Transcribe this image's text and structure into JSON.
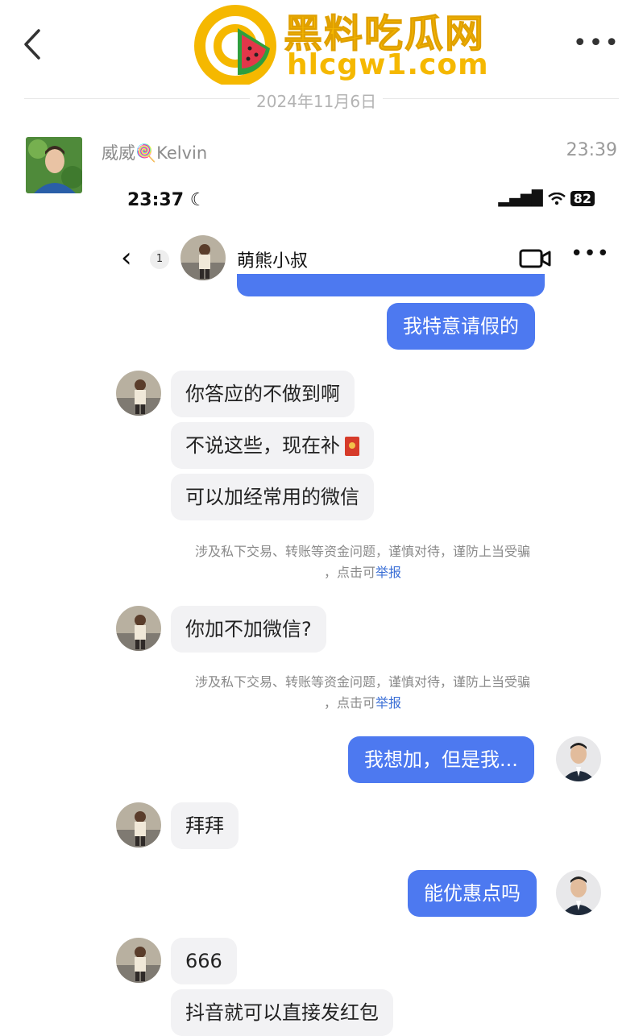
{
  "header": {
    "logo_title": "黑料吃瓜网",
    "logo_url": "hlcgw1.com",
    "more": "•••"
  },
  "date": "2024年11月6日",
  "post": {
    "sender": "威威🍭Kelvin",
    "time": "23:39"
  },
  "inner": {
    "status_time": "23:37",
    "battery": "82",
    "back_badge": "1",
    "contact_name": "萌熊小叔",
    "more": "•••"
  },
  "messages": [
    {
      "from": "me",
      "text": "我特意请假的"
    },
    {
      "from": "them",
      "text": "你答应的不做到啊"
    },
    {
      "from": "them",
      "text": "不说这些，现在补"
    },
    {
      "from": "them",
      "text": "可以加经常用的微信"
    },
    {
      "from": "them",
      "text": "你加不加微信?"
    },
    {
      "from": "me",
      "text": "我想加，但是我..."
    },
    {
      "from": "them",
      "text": "拜拜"
    },
    {
      "from": "me",
      "text": "能优惠点吗"
    },
    {
      "from": "them",
      "text": "666"
    },
    {
      "from": "them",
      "text": "抖音就可以直接发红包"
    }
  ],
  "warning": {
    "line1": "涉及私下交易、转账等资金问题，谨慎对待，谨防上当受骗",
    "line2_prefix": "，点击可",
    "report": "举报"
  },
  "colors": {
    "me_bubble": "#4d79f0",
    "them_bubble": "#f2f2f4",
    "logo": "#f5b800"
  }
}
